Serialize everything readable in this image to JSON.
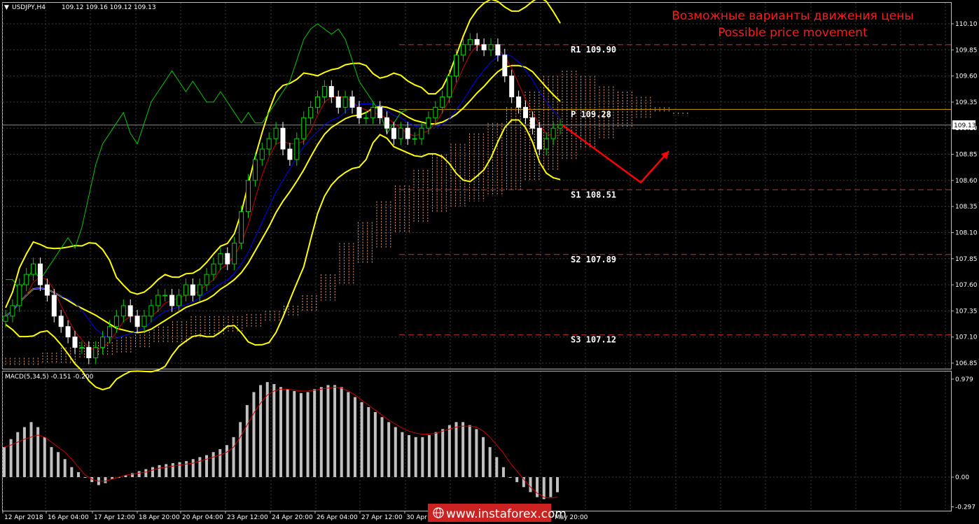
{
  "header": {
    "symbol": "USDJPY,H4",
    "ohlc": "109.12 109.16 109.12 109.13",
    "menu_glyph": "▼"
  },
  "annotation": {
    "ru": "Возможные варианты движения цены",
    "en": "Possible price movement"
  },
  "current_price": "109.13",
  "macd": {
    "label": "MACD(5,34,5) -0.151 -0.200",
    "axis_labels": [
      "0.979",
      "0.00",
      "-0.297"
    ]
  },
  "watermark": {
    "text": "www.instaforex.com",
    "logo_icon": "globe-icon"
  },
  "colors": {
    "background": "#000000",
    "grid": "#3a3a3a",
    "bull": "#00d000",
    "bear": "#ffffff",
    "bollinger": "#ffff00",
    "tenkan": "#cc0000",
    "kijun": "#0000ff",
    "chikou": "#00c800",
    "cloud": "#e8a070",
    "levels": "#cc3333",
    "pivot": "#c8a000",
    "arrow": "#ff0000",
    "macd_hist": "#c0c0c0",
    "macd_signal": "#cc0000"
  },
  "chart_data": {
    "type": "candlestick",
    "timeframe": "H4",
    "ylim": [
      106.75,
      110.23
    ],
    "y_ticks": [
      "110.10",
      "109.85",
      "109.60",
      "109.35",
      "109.10",
      "108.85",
      "108.60",
      "108.35",
      "108.10",
      "107.85",
      "107.60",
      "107.35",
      "107.10",
      "106.85"
    ],
    "x_ticks": [
      "12 Apr 2018",
      "16 Apr 04:00",
      "17 Apr 12:00",
      "18 Apr 20:00",
      "20 Apr 04:00",
      "23 Apr 12:00",
      "24 Apr 20:00",
      "26 Apr 04:00",
      "27 Apr 12:00",
      "30 Apr 20:00",
      "May 20:00"
    ],
    "levels": [
      {
        "name": "R1",
        "value": 109.9,
        "label": "R1 109.90"
      },
      {
        "name": "P",
        "value": 109.28,
        "label": "P 109.28"
      },
      {
        "name": "S1",
        "value": 108.51,
        "label": "S1 108.51"
      },
      {
        "name": "S2",
        "value": 107.89,
        "label": "S2 107.89"
      },
      {
        "name": "S3",
        "value": 107.12,
        "label": "S3 107.12"
      }
    ],
    "close_series": [
      107.3,
      107.4,
      107.6,
      107.7,
      107.8,
      107.6,
      107.5,
      107.3,
      107.2,
      107.1,
      107.0,
      107.0,
      106.9,
      107.0,
      107.1,
      107.2,
      107.3,
      107.4,
      107.3,
      107.2,
      107.3,
      107.4,
      107.5,
      107.5,
      107.4,
      107.5,
      107.6,
      107.5,
      107.6,
      107.7,
      107.8,
      107.9,
      107.8,
      108.0,
      108.3,
      108.6,
      108.8,
      108.9,
      109.0,
      109.1,
      108.9,
      108.8,
      109.0,
      109.2,
      109.3,
      109.4,
      109.5,
      109.4,
      109.3,
      109.4,
      109.3,
      109.2,
      109.2,
      109.3,
      109.2,
      109.1,
      109.0,
      109.1,
      109.0,
      109.0,
      109.1,
      109.2,
      109.3,
      109.4,
      109.6,
      109.8,
      109.9,
      109.95,
      109.9,
      109.85,
      109.9,
      109.8,
      109.6,
      109.4,
      109.3,
      109.2,
      109.1,
      108.9,
      109.0,
      109.1,
      109.13
    ],
    "forecast_path": [
      [
        109.13,
        0
      ],
      [
        108.58,
        1
      ],
      [
        108.88,
        2
      ]
    ],
    "macd_hist": [
      0.3,
      0.38,
      0.45,
      0.5,
      0.55,
      0.5,
      0.4,
      0.3,
      0.25,
      0.18,
      0.1,
      0.05,
      0.0,
      -0.05,
      -0.08,
      -0.06,
      -0.02,
      0.0,
      0.02,
      0.04,
      0.06,
      0.08,
      0.1,
      0.12,
      0.13,
      0.14,
      0.15,
      0.16,
      0.18,
      0.2,
      0.22,
      0.25,
      0.28,
      0.32,
      0.4,
      0.55,
      0.72,
      0.85,
      0.92,
      0.95,
      0.93,
      0.9,
      0.88,
      0.86,
      0.84,
      0.85,
      0.88,
      0.9,
      0.92,
      0.92,
      0.9,
      0.85,
      0.8,
      0.75,
      0.7,
      0.65,
      0.6,
      0.55,
      0.5,
      0.45,
      0.42,
      0.4,
      0.4,
      0.42,
      0.45,
      0.48,
      0.52,
      0.55,
      0.55,
      0.52,
      0.48,
      0.4,
      0.3,
      0.2,
      0.1,
      0.0,
      -0.05,
      -0.1,
      -0.15,
      -0.2,
      -0.22,
      -0.2,
      -0.151
    ],
    "macd_signal": [
      0.3,
      0.32,
      0.35,
      0.38,
      0.4,
      0.42,
      0.4,
      0.35,
      0.3,
      0.25,
      0.18,
      0.1,
      0.02,
      -0.02,
      -0.04,
      -0.04,
      -0.02,
      0.0,
      0.02,
      0.03,
      0.04,
      0.05,
      0.07,
      0.09,
      0.1,
      0.11,
      0.12,
      0.13,
      0.14,
      0.16,
      0.18,
      0.2,
      0.22,
      0.25,
      0.3,
      0.4,
      0.52,
      0.64,
      0.74,
      0.82,
      0.86,
      0.88,
      0.88,
      0.87,
      0.86,
      0.86,
      0.87,
      0.88,
      0.89,
      0.9,
      0.89,
      0.86,
      0.82,
      0.77,
      0.72,
      0.67,
      0.62,
      0.57,
      0.53,
      0.49,
      0.46,
      0.44,
      0.43,
      0.43,
      0.44,
      0.46,
      0.48,
      0.5,
      0.51,
      0.51,
      0.5,
      0.46,
      0.4,
      0.32,
      0.24,
      0.14,
      0.06,
      -0.02,
      -0.1,
      -0.16,
      -0.2,
      -0.21,
      -0.2
    ]
  }
}
